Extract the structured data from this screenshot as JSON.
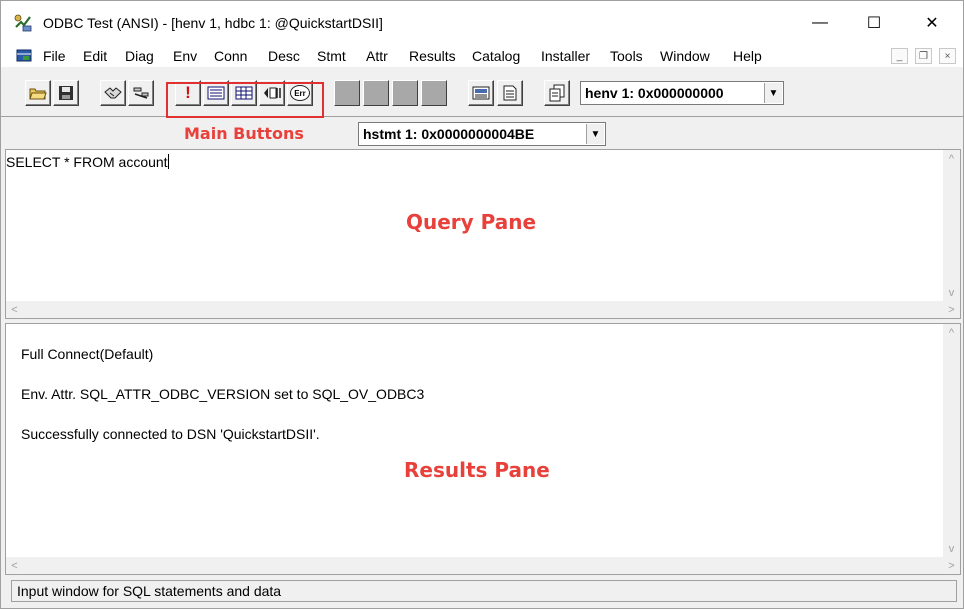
{
  "window": {
    "title": "ODBC Test (ANSI) - [henv 1, hdbc 1: @QuickstartDSII]",
    "minimize_glyph": "—",
    "maximize_glyph": "☐",
    "close_glyph": "✕"
  },
  "menu": {
    "items": [
      "File",
      "Edit",
      "Diag",
      "Env",
      "Conn",
      "Desc",
      "Stmt",
      "Attr",
      "Results",
      "Catalog",
      "Installer",
      "Tools",
      "Window",
      "Help"
    ],
    "mdi_minimize_glyph": "_",
    "mdi_restore_glyph": "❐",
    "mdi_close_glyph": "×"
  },
  "toolbar": {
    "henv_combo": "henv 1:  0x000000000",
    "hstmt_combo": "hstmt 1:  0x0000000004BE",
    "combo_arrow": "▼",
    "exec_glyph": "!",
    "err_glyph": "Err"
  },
  "annotations": {
    "main_buttons": "Main Buttons",
    "query_pane": "Query Pane",
    "results_pane": "Results Pane"
  },
  "query": {
    "text": "SELECT * FROM account"
  },
  "results": {
    "lines": [
      "Full Connect(Default)",
      "Env. Attr. SQL_ATTR_ODBC_VERSION set to SQL_OV_ODBC3",
      "Successfully connected to DSN 'QuickstartDSII'."
    ]
  },
  "scroll": {
    "up": "^",
    "down": "v",
    "left": "<",
    "right": ">"
  },
  "status": {
    "text": "Input window for SQL statements and data"
  },
  "colors": {
    "annotation_red": "#e8403a",
    "disabled_button": "#a8a8a8"
  }
}
